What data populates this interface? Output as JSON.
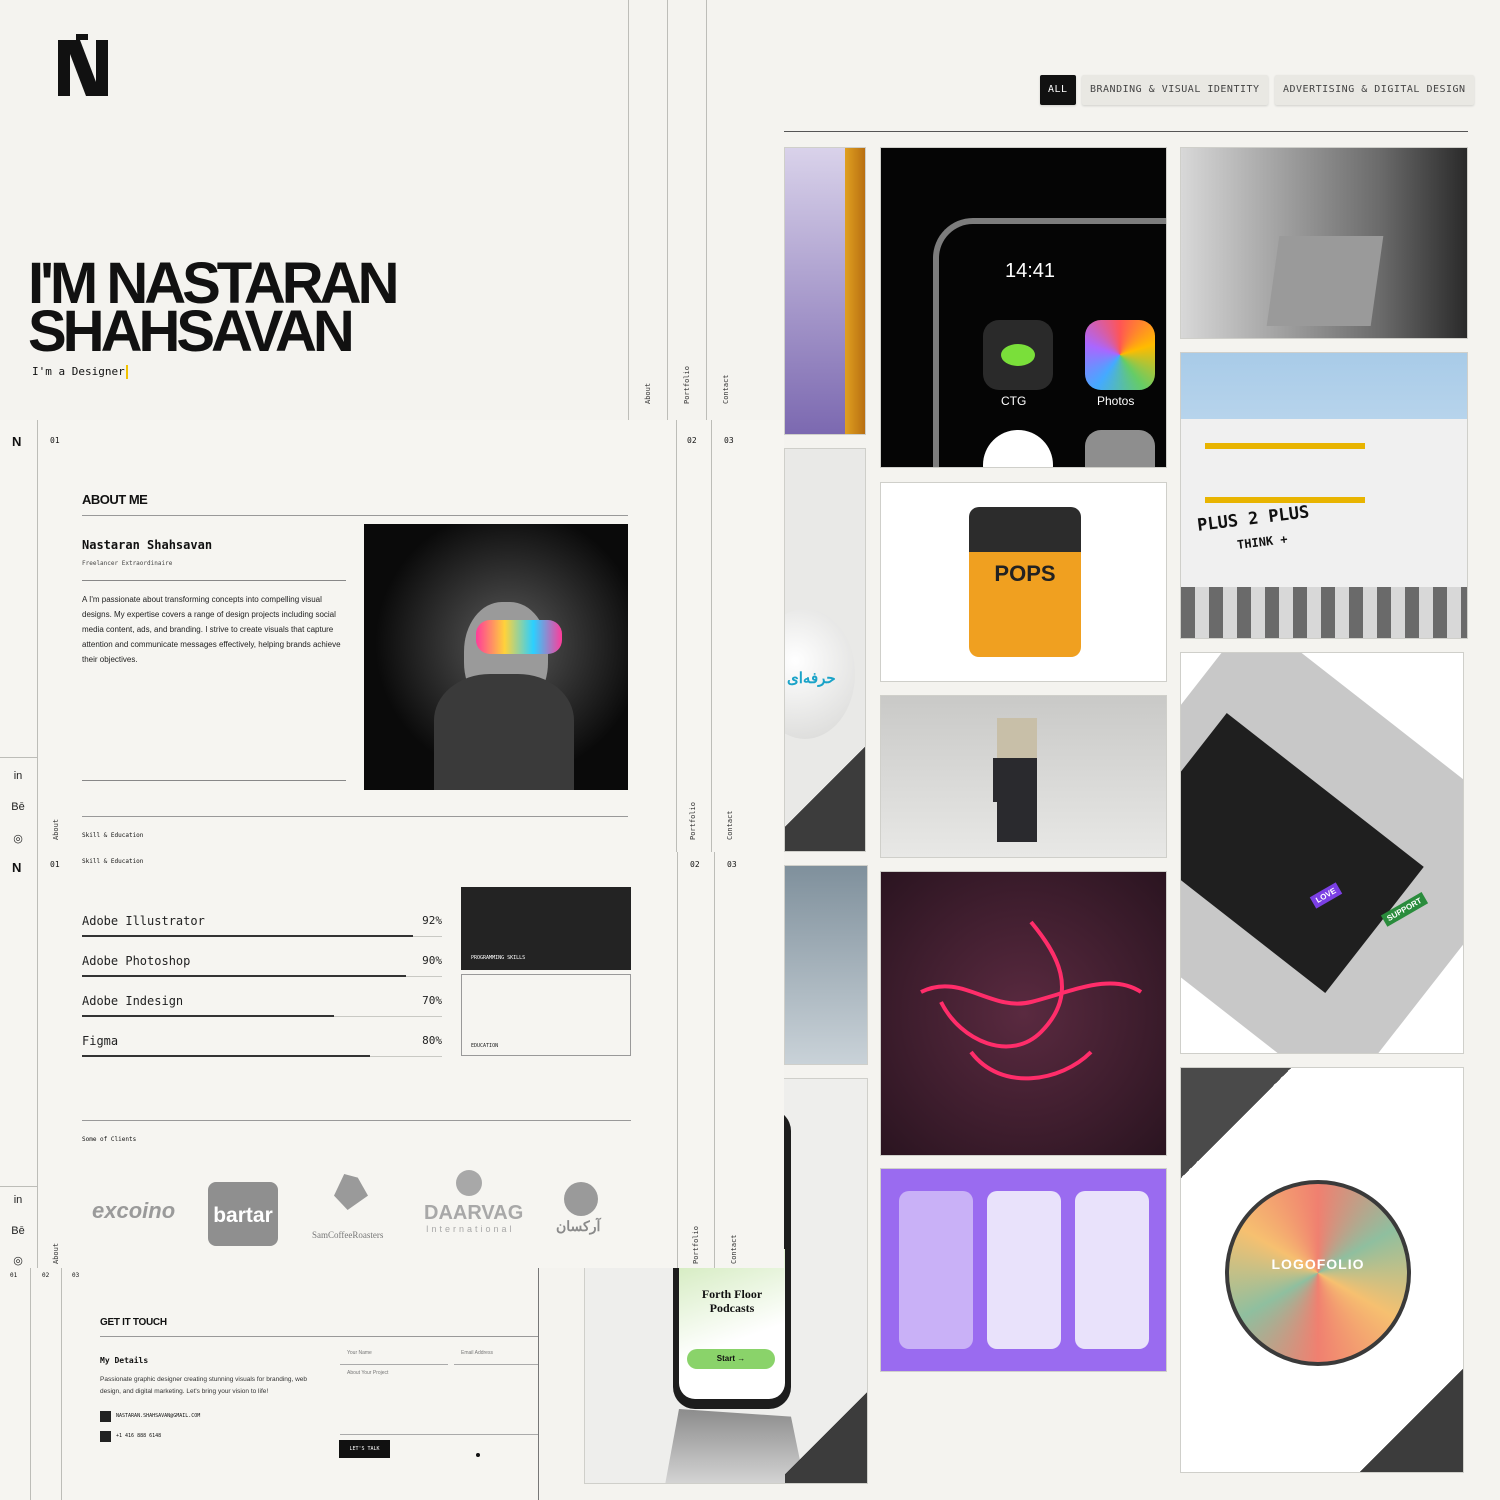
{
  "hero": {
    "logo": "N",
    "name_line1": "I'M NASTARAN",
    "name_line2": "SHAHSAVAN",
    "tagline": "I'm a Designer",
    "nav": [
      "About",
      "Portfolio",
      "Contact"
    ]
  },
  "filters": {
    "items": [
      "ALL",
      "BRANDING & VISUAL IDENTITY",
      "ADVERTISING & DIGITAL DESIGN"
    ],
    "active": "ALL"
  },
  "gallery": {
    "phone_time": "14:41",
    "app_ctg": "CTG",
    "app_photos": "Photos",
    "pops_label": "POPS",
    "sign_line1": "PLUS 2 PLUS",
    "sign_line2": "THINK +",
    "logofolio": "LOGOFOLIO",
    "podcast_title": "Forth Floor Podcasts",
    "podcast_button": "Start →",
    "arabic_caption": "حرفه‌ای",
    "sticker1": "LOVE",
    "sticker2": "SUPPORT"
  },
  "about": {
    "index_left": "01",
    "index_mid": "02",
    "index_right": "03",
    "heading": "ABOUT ME",
    "person_name": "Nastaran Shahsavan",
    "person_role": "Freelancer Extraordinaire",
    "bio": "A I'm passionate about transforming concepts into compelling visual designs. My expertise covers a range of design projects including social media content, ads, and branding. I strive to create visuals that capture attention and communicate messages effectively, helping brands achieve their objectives.",
    "footer_label": "Skill & Education",
    "nav_left": "About",
    "nav_mid": "Portfolio",
    "nav_right": "Contact",
    "socials": [
      "in",
      "Bē",
      "◎"
    ]
  },
  "skills": {
    "index_left": "01",
    "index_mid": "02",
    "index_right": "03",
    "header": "Skill & Education",
    "items": [
      {
        "name": "Adobe Illustrator",
        "pct_label": "92%",
        "value": 0.92
      },
      {
        "name": "Adobe Photoshop",
        "pct_label": "90%",
        "value": 0.9
      },
      {
        "name": "Adobe Indesign",
        "pct_label": "70%",
        "value": 0.7
      },
      {
        "name": "Figma",
        "pct_label": "80%",
        "value": 0.8
      }
    ],
    "card_programming": "PROGRAMMING SKILLS",
    "card_education": "EDUCATION",
    "clients_label": "Some of Clients",
    "clients": [
      "excoino",
      "bartar",
      "SamCoffeeRoasters",
      "DAARVAG",
      "International",
      "آرکسان"
    ],
    "nav_left": "About",
    "nav_mid": "Portfolio",
    "nav_right": "Contact",
    "socials": [
      "in",
      "Bē",
      "◎"
    ]
  },
  "contact": {
    "index": [
      "01",
      "02",
      "03"
    ],
    "heading": "GET IT TOUCH",
    "details_title": "My Details",
    "details_text": "Passionate graphic designer creating stunning visuals for branding, web design, and digital marketing. Let's bring your vision to life!",
    "email": "NASTARAN.SHAHSAVAN@GMAIL.COM",
    "phone": "+1 416 888 6148",
    "name_placeholder": "Your Name",
    "email_placeholder": "Email Address",
    "project_placeholder": "About Your Project",
    "submit": "LET'S TALK"
  },
  "colors": {
    "background": "#f4f3ef",
    "ink": "#111111",
    "cursor": "#f2c200",
    "purple": "#9a6bf0",
    "neon": "#ff2d6a",
    "sign_gold": "#e8b400"
  }
}
